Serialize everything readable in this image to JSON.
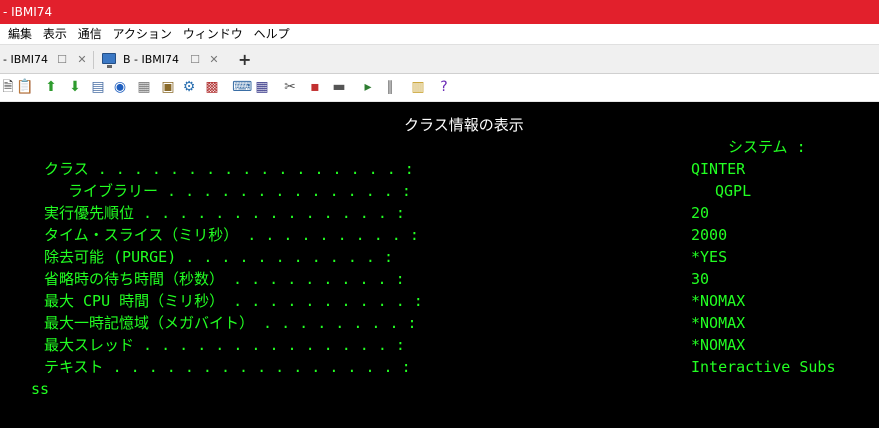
{
  "window": {
    "title": "- IBMI74"
  },
  "menu": [
    "編集",
    "表示",
    "通信",
    "アクション",
    "ウィンドウ",
    "ヘルプ"
  ],
  "tabs": [
    {
      "label": "- IBMI74",
      "restore": "☐",
      "close": "✕"
    },
    {
      "label": "B - IBMI74",
      "restore": "☐",
      "close": "✕"
    }
  ],
  "new_tab": "+",
  "toolbar_icons": [
    {
      "name": "copy-icon",
      "glyph": "🗎",
      "color": "#444"
    },
    {
      "name": "paste-icon",
      "glyph": "📋",
      "color": "#7a5a1a"
    },
    {
      "name": "upload-icon",
      "glyph": "⬆",
      "color": "#2e9b2e"
    },
    {
      "name": "download-icon",
      "glyph": "⬇",
      "color": "#2e9b2e"
    },
    {
      "name": "clipboard-icon",
      "glyph": "▤",
      "color": "#4a6fa5"
    },
    {
      "name": "compass-icon",
      "glyph": "◉",
      "color": "#1f5fbf"
    },
    {
      "name": "document-icon",
      "glyph": "▦",
      "color": "#777"
    },
    {
      "name": "package-icon",
      "glyph": "▣",
      "color": "#8a6a2a"
    },
    {
      "name": "settings-icon",
      "glyph": "⚙",
      "color": "#2a6fb0"
    },
    {
      "name": "macro-icon",
      "glyph": "▩",
      "color": "#b03030"
    },
    {
      "name": "keyboard-icon",
      "glyph": "⌨",
      "color": "#3a6ea5"
    },
    {
      "name": "grid-icon",
      "glyph": "▦",
      "color": "#3a3a8a"
    },
    {
      "name": "tools-icon",
      "glyph": "✂",
      "color": "#555"
    },
    {
      "name": "record-icon",
      "glyph": "▪",
      "color": "#c23030"
    },
    {
      "name": "stop-icon",
      "glyph": "▬",
      "color": "#555"
    },
    {
      "name": "play-icon",
      "glyph": "▸",
      "color": "#2e7d32"
    },
    {
      "name": "pause-icon",
      "glyph": "∥",
      "color": "#555"
    },
    {
      "name": "notes-icon",
      "glyph": "▥",
      "color": "#c49a20"
    },
    {
      "name": "help-icon",
      "glyph": "?",
      "color": "#6a2ab5"
    }
  ],
  "screen": {
    "title": "クラス情報の表示",
    "system_label": "システム :",
    "fields": [
      {
        "label": "クラス . . . . . . . . . . . . . . . . . :",
        "value": "QINTER"
      },
      {
        "label": "ライブラリー . . . . . . . . . . . . . :",
        "value": "QGPL"
      },
      {
        "label": "実行優先順位 . . . . . . . . . . . . . . :",
        "value": "20"
      },
      {
        "label": "タイム・スライス（ミリ秒） . . . . . . . . . :",
        "value": "2000"
      },
      {
        "label": "除去可能 (PURGE) . . . . . . . . . . . :",
        "value": "*YES"
      },
      {
        "label": "省略時の待ち時間（秒数） . . . . . . . . . :",
        "value": "30"
      },
      {
        "label": "最大 CPU 時間（ミリ秒） . . . . . . . . . . :",
        "value": "*NOMAX"
      },
      {
        "label": "最大一時記憶域（メガバイト） . . . . . . . . :",
        "value": "*NOMAX"
      },
      {
        "label": "最大スレッド . . . . . . . . . . . . . . :",
        "value": "*NOMAX"
      },
      {
        "label": "テキスト . . . . . . . . . . . . . . . . :",
        "value": "Interactive Subs"
      }
    ],
    "continuation": "ss"
  }
}
